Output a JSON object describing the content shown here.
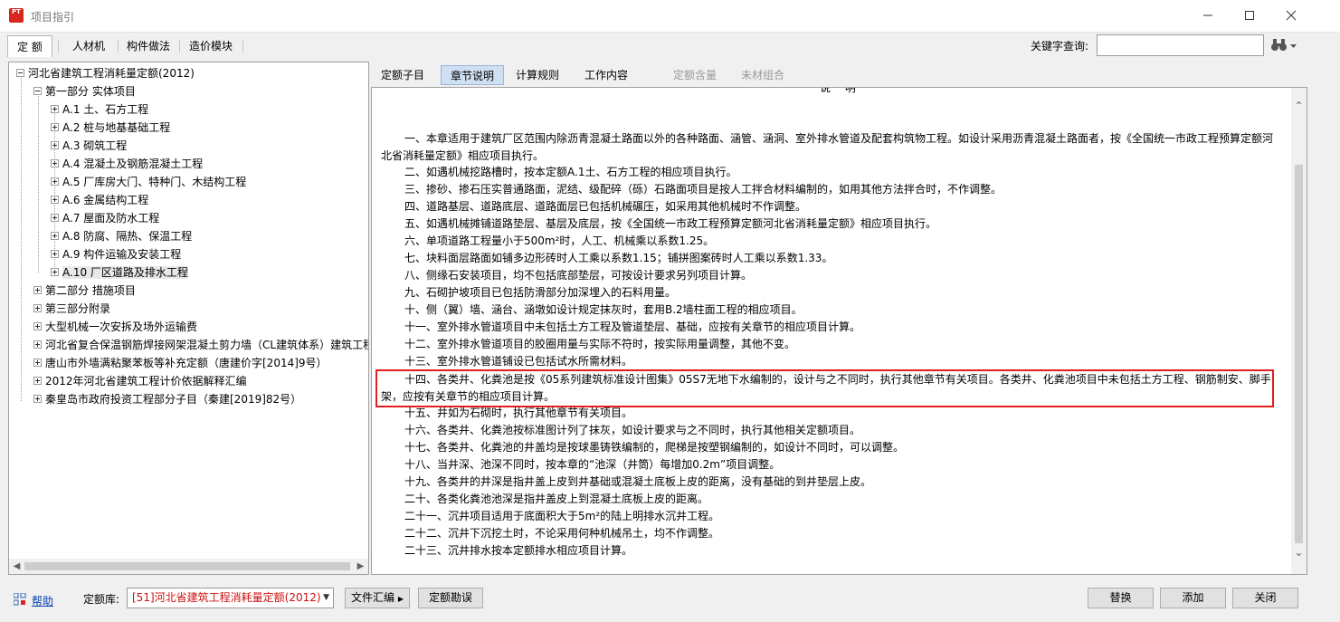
{
  "window": {
    "title": "项目指引",
    "app_icon_text": "PT",
    "colors": {
      "accent_red": "#e02020",
      "active_tab": "#cfe0f3",
      "link": "#0645ad"
    }
  },
  "top_tabs": [
    "定 额",
    "人材机",
    "构件做法",
    "造价模块"
  ],
  "search": {
    "label": "关键字查询:",
    "value": ""
  },
  "tree": {
    "root": "河北省建筑工程消耗量定额(2012)",
    "part1": "第一部分 实体项目",
    "part1_items": [
      "A.1 土、石方工程",
      "A.2 桩与地基基础工程",
      "A.3 砌筑工程",
      "A.4 混凝土及钢筋混凝土工程",
      "A.5 厂库房大门、特种门、木结构工程",
      "A.6 金属结构工程",
      "A.7 屋面及防水工程",
      "A.8 防腐、隔热、保温工程",
      "A.9 构件运输及安装工程",
      "A.10 厂区道路及排水工程"
    ],
    "others": [
      "第二部分 措施项目",
      "第三部分附录",
      "大型机械一次安拆及场外运输费",
      "河北省复合保温钢筋焊接网架混凝土剪力墙（CL建筑体系）建筑工程",
      "唐山市外墙满粘聚苯板等补充定额（唐建价字[2014]9号）",
      "2012年河北省建筑工程计价依据解释汇编",
      "秦皇岛市政府投资工程部分子目（秦建[2019]82号）"
    ]
  },
  "right_tabs": [
    {
      "label": "定额子目",
      "state": "normal"
    },
    {
      "label": "章节说明",
      "state": "active"
    },
    {
      "label": "计算规则",
      "state": "normal"
    },
    {
      "label": "工作内容",
      "state": "normal"
    },
    {
      "label": "定额含量",
      "state": "disabled"
    },
    {
      "label": "未材组合",
      "state": "disabled"
    }
  ],
  "document": {
    "heading": "说 明",
    "para1": "一、本章适用于建筑厂区范围内除沥青混凝土路面以外的各种路面、涵管、涵洞、室外排水管道及配套构筑物工程。如设计采用沥青混凝土路面者，按《全国统一市政工程预算定额河北省消耗量定额》相应项目执行。",
    "lines_a": [
      "二、如遇机械挖路槽时，按本定额A.1土、石方工程的相应项目执行。",
      "三、掺砂、掺石压实普通路面，泥结、级配碎（砾）石路面项目是按人工拌合材料编制的，如用其他方法拌合时，不作调整。",
      "四、道路基层、道路底层、道路面层已包括机械碾压，如采用其他机械时不作调整。",
      "五、如遇机械摊铺道路垫层、基层及底层，按《全国统一市政工程预算定额河北省消耗量定额》相应项目执行。",
      "六、单项道路工程量小于500m²时，人工、机械乘以系数1.25。",
      "七、块料面层路面如铺多边形砖时人工乘以系数1.15；铺拼图案砖时人工乘以系数1.33。",
      "八、侧缘石安装项目，均不包括底部垫层，可按设计要求另列项目计算。",
      "九、石砌护坡项目已包括防滑部分加深埋入的石料用量。",
      "十、侧（翼）墙、涵台、涵墩如设计规定抹灰时，套用B.2墙柱面工程的相应项目。",
      "十一、室外排水管道项目中未包括土方工程及管道垫层、基础，应按有关章节的相应项目计算。",
      "十二、室外排水管道项目的胶圈用量与实际不符时，按实际用量调整，其他不变。",
      "十三、室外排水管道铺设已包括试水所需材料。"
    ],
    "para14": "十四、各类井、化粪池是按《05系列建筑标准设计图集》05S7无地下水编制的，设计与之不同时，执行其他章节有关项目。各类井、化粪池项目中未包括土方工程、钢筋制安、脚手架，应按有关章节的相应项目计算。",
    "lines_b": [
      "十五、井如为石砌时，执行其他章节有关项目。",
      "十六、各类井、化粪池按标准图计列了抹灰，如设计要求与之不同时，执行其他相关定额项目。",
      "十七、各类井、化粪池的井盖均是按球墨铸铁编制的，爬梯是按塑钢编制的，如设计不同时，可以调整。",
      "十八、当井深、池深不同时，按本章的“池深（井筒）每增加0.2m”项目调整。",
      "十九、各类井的井深是指井盖上皮到井基础或混凝土底板上皮的距离，没有基础的到井垫层上皮。",
      "二十、各类化粪池池深是指井盖皮上到混凝土底板上皮的距离。",
      "二十一、沉井项目适用于底面积大于5m²的陆上明排水沉井工程。",
      "二十二、沉井下沉挖土时，不论采用何种机械吊土，均不作调整。",
      "二十三、沉井排水按本定额排水相应项目计算。"
    ]
  },
  "bottom": {
    "help": "帮助",
    "library_label": "定额库:",
    "library_value": "[51]河北省建筑工程消耗量定额(2012)",
    "file_button": "文件汇编",
    "errata_button": "定额勘误",
    "replace_button": "替换",
    "add_button": "添加",
    "close_button": "关闭"
  }
}
